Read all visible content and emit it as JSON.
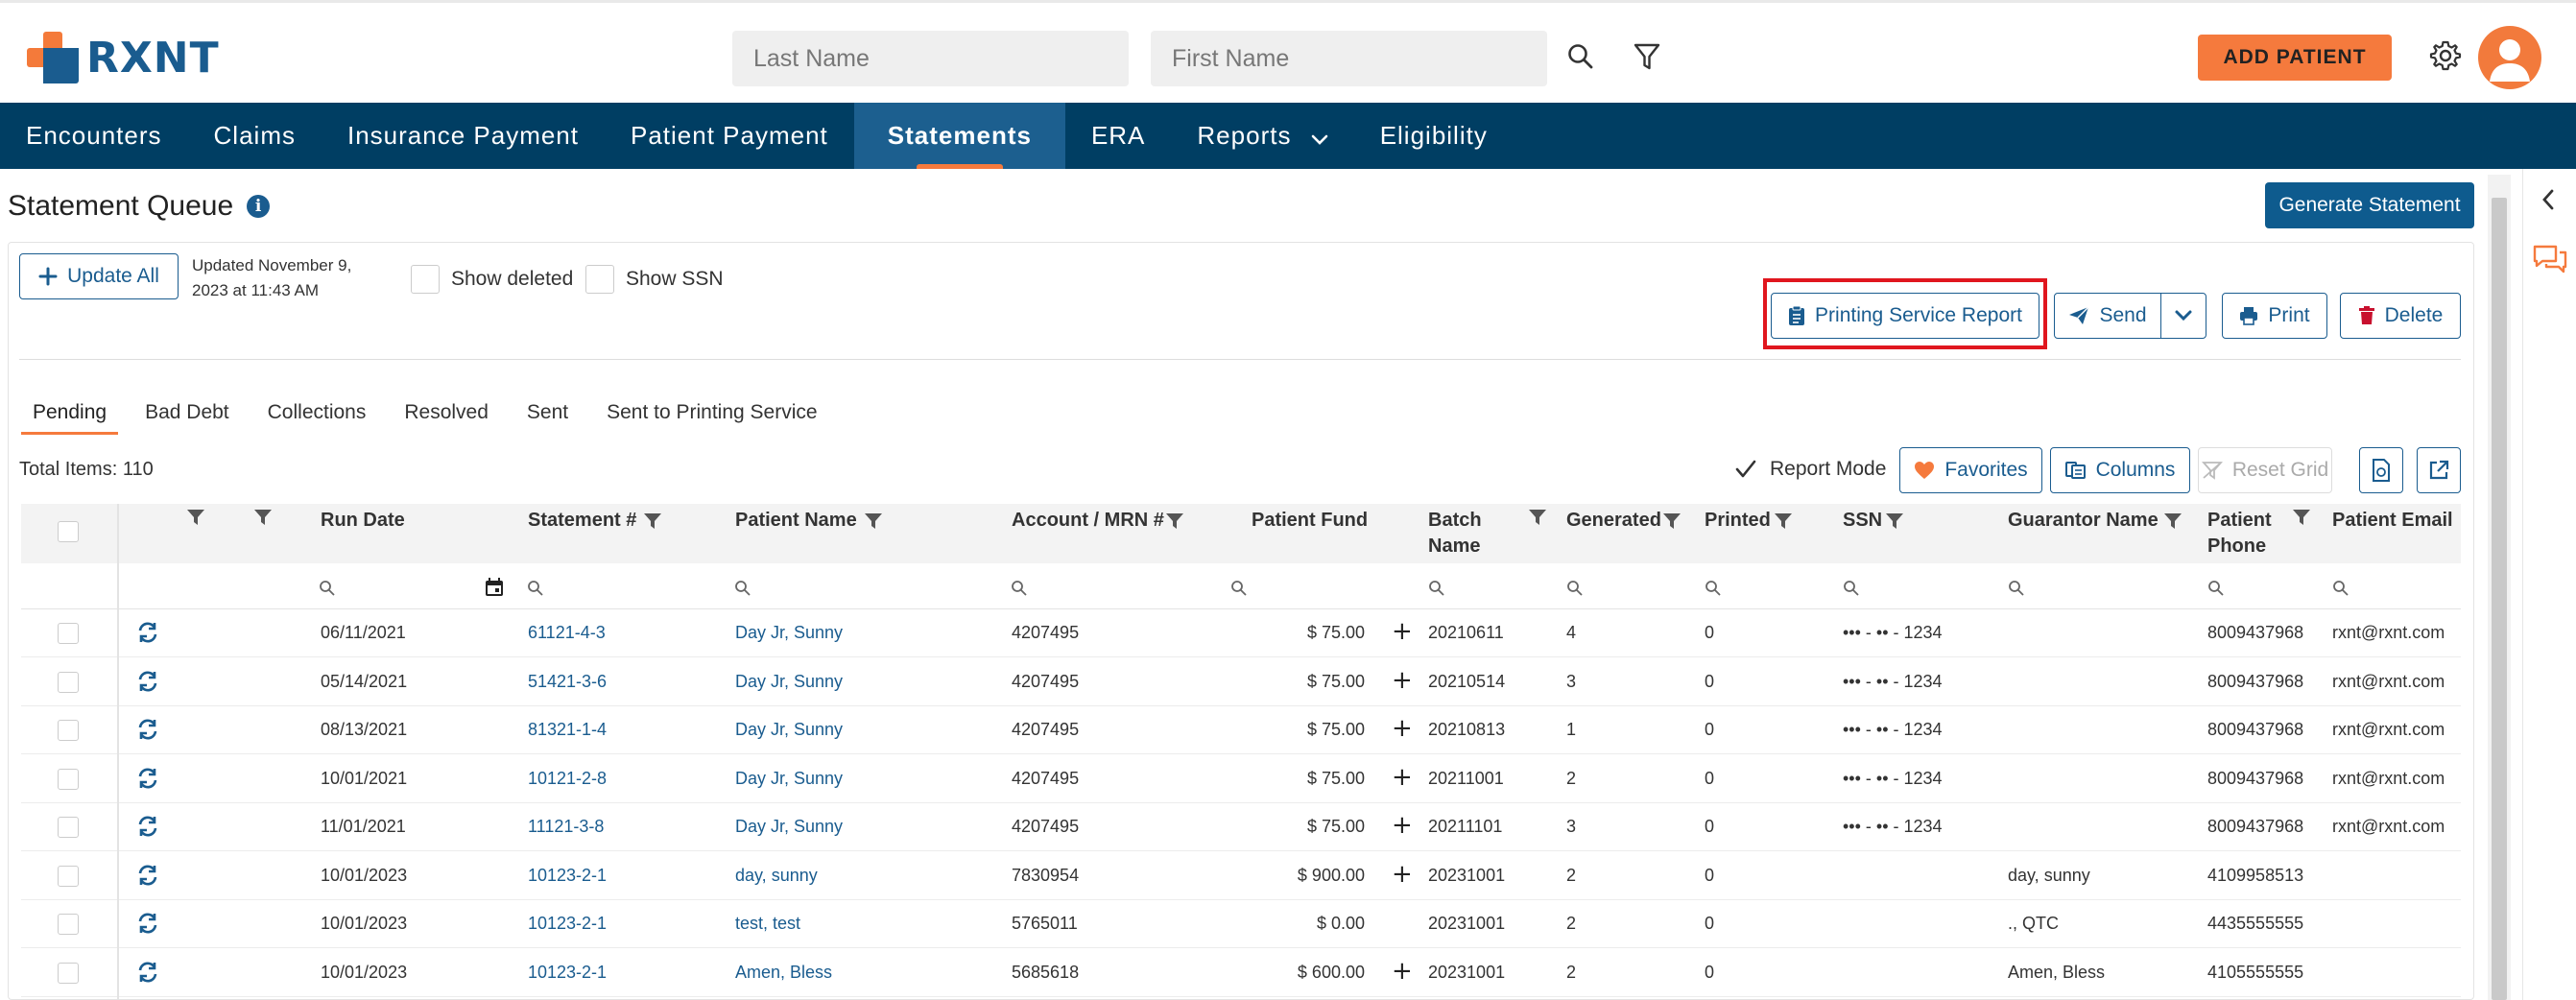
{
  "brand": {
    "name": "RXNT"
  },
  "search": {
    "last_name_placeholder": "Last Name",
    "first_name_placeholder": "First Name"
  },
  "header": {
    "add_patient_label": "ADD PATIENT"
  },
  "nav": {
    "items": [
      {
        "label": "Encounters"
      },
      {
        "label": "Claims"
      },
      {
        "label": "Insurance Payment"
      },
      {
        "label": "Patient Payment"
      },
      {
        "label": "Statements",
        "active": true
      },
      {
        "label": "ERA"
      },
      {
        "label": "Reports",
        "has_dropdown": true
      },
      {
        "label": "Eligibility"
      }
    ]
  },
  "page": {
    "title": "Statement Queue",
    "generate_label": "Generate Statement",
    "update_all_label": "Update All",
    "updated_line1": "Updated November 9,",
    "updated_line2": "2023 at 11:43 AM",
    "show_deleted_label": "Show deleted",
    "show_ssn_label": "Show SSN",
    "printing_service_report_label": "Printing Service Report",
    "send_label": "Send",
    "print_label": "Print",
    "delete_label": "Delete"
  },
  "tabs": [
    {
      "label": "Pending",
      "active": true
    },
    {
      "label": "Bad Debt"
    },
    {
      "label": "Collections"
    },
    {
      "label": "Resolved"
    },
    {
      "label": "Sent"
    },
    {
      "label": "Sent to Printing Service"
    }
  ],
  "grid_toolbar": {
    "total_items": "Total Items: 110",
    "report_mode_label": "Report Mode",
    "report_mode_checked": true,
    "favorites_label": "Favorites",
    "columns_label": "Columns",
    "reset_grid_label": "Reset Grid"
  },
  "columns": {
    "run_date": "Run Date",
    "statement": "Statement #",
    "patient_name": "Patient Name",
    "account": "Account / MRN #",
    "patient_fund": "Patient Fund",
    "batch_name_1": "Batch",
    "batch_name_2": "Name",
    "generated": "Generated",
    "printed": "Printed",
    "ssn": "SSN",
    "guarantor": "Guarantor Name",
    "phone_1": "Patient",
    "phone_2": "Phone",
    "email": "Patient Email"
  },
  "rows": [
    {
      "run_date": "06/11/2021",
      "statement": "61121-4-3",
      "patient": "Day Jr, Sunny",
      "account": "4207495",
      "fund": "$ 75.00",
      "batch": "20210611",
      "generated": "4",
      "printed": "0",
      "ssn": "••• - •• - 1234",
      "guarantor": "",
      "phone": "8009437968",
      "email": "rxnt@rxnt.com"
    },
    {
      "run_date": "05/14/2021",
      "statement": "51421-3-6",
      "patient": "Day Jr, Sunny",
      "account": "4207495",
      "fund": "$ 75.00",
      "batch": "20210514",
      "generated": "3",
      "printed": "0",
      "ssn": "••• - •• - 1234",
      "guarantor": "",
      "phone": "8009437968",
      "email": "rxnt@rxnt.com"
    },
    {
      "run_date": "08/13/2021",
      "statement": "81321-1-4",
      "patient": "Day Jr, Sunny",
      "account": "4207495",
      "fund": "$ 75.00",
      "batch": "20210813",
      "generated": "1",
      "printed": "0",
      "ssn": "••• - •• - 1234",
      "guarantor": "",
      "phone": "8009437968",
      "email": "rxnt@rxnt.com"
    },
    {
      "run_date": "10/01/2021",
      "statement": "10121-2-8",
      "patient": "Day Jr, Sunny",
      "account": "4207495",
      "fund": "$ 75.00",
      "batch": "20211001",
      "generated": "2",
      "printed": "0",
      "ssn": "••• - •• - 1234",
      "guarantor": "",
      "phone": "8009437968",
      "email": "rxnt@rxnt.com"
    },
    {
      "run_date": "11/01/2021",
      "statement": "11121-3-8",
      "patient": "Day Jr, Sunny",
      "account": "4207495",
      "fund": "$ 75.00",
      "batch": "20211101",
      "generated": "3",
      "printed": "0",
      "ssn": "••• - •• - 1234",
      "guarantor": "",
      "phone": "8009437968",
      "email": "rxnt@rxnt.com"
    },
    {
      "run_date": "10/01/2023",
      "statement": "10123-2-1",
      "patient": "day, sunny",
      "account": "7830954",
      "fund": "$ 900.00",
      "batch": "20231001",
      "generated": "2",
      "printed": "0",
      "ssn": "",
      "guarantor": "day, sunny",
      "phone": "4109958513",
      "email": ""
    },
    {
      "run_date": "10/01/2023",
      "statement": "10123-2-1",
      "patient": "test, test",
      "account": "5765011",
      "fund": "$ 0.00",
      "batch": "20231001",
      "generated": "2",
      "printed": "0",
      "ssn": "",
      "guarantor": "., QTC",
      "phone": "4435555555",
      "email": ""
    },
    {
      "run_date": "10/01/2023",
      "statement": "10123-2-1",
      "patient": "Amen, Bless",
      "account": "5685618",
      "fund": "$ 600.00",
      "batch": "20231001",
      "generated": "2",
      "printed": "0",
      "ssn": "",
      "guarantor": "Amen, Bless",
      "phone": "4105555555",
      "email": ""
    }
  ],
  "row_plus_flags": [
    true,
    true,
    true,
    true,
    true,
    true,
    false,
    true
  ],
  "colors": {
    "primary": "#003e63",
    "accent": "#f57a3d",
    "link": "#1a5c8f",
    "highlight": "#e0161e"
  }
}
